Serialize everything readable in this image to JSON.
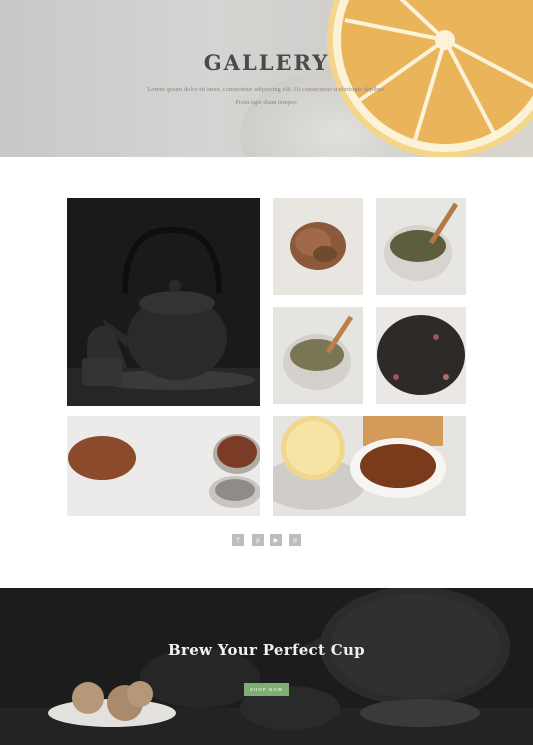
{
  "hero": {
    "title": "GALLERY",
    "subtitle": "Lorem ipsum dolor sit amet, consectetur adipiscing elit. Ut consectetur scelerisque dapibus. Proin eget diam tempor."
  },
  "gallery": {
    "images": [
      {
        "subject": "cast iron teapot"
      },
      {
        "subject": "loose herbal tea pile"
      },
      {
        "subject": "green tea in mortar with wooden spoon"
      },
      {
        "subject": "herbal blend in mortar with wooden spoon"
      },
      {
        "subject": "black tea with rose petals"
      },
      {
        "subject": "rooibos tea and tin"
      },
      {
        "subject": "lemon slice and cup of tea"
      }
    ]
  },
  "social": {
    "icons": [
      {
        "name": "facebook-icon",
        "glyph": "f"
      },
      {
        "name": "pinterest-icon",
        "glyph": "p"
      },
      {
        "name": "youtube-icon",
        "glyph": "▶"
      },
      {
        "name": "instagram-icon",
        "glyph": "◎"
      }
    ]
  },
  "cta": {
    "title": "Brew Your Perfect Cup",
    "button_label": "SHOP NOW",
    "button_color": "#7fae72"
  }
}
